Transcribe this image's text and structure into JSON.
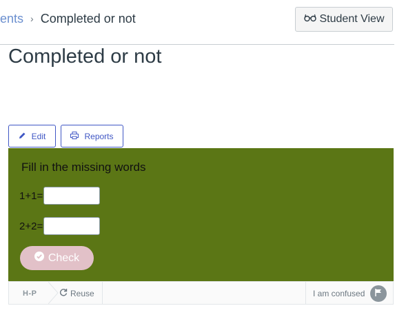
{
  "breadcrumb": {
    "parent": "ents",
    "separator": "›",
    "current": "Completed or not"
  },
  "header": {
    "student_view_label": "Student View"
  },
  "page": {
    "title": "Completed or not"
  },
  "toolbar": {
    "edit_label": "Edit",
    "reports_label": "Reports"
  },
  "h5p": {
    "task_description": "Fill in the missing words",
    "questions": [
      {
        "prompt": "1+1=",
        "value": ""
      },
      {
        "prompt": "2+2=",
        "value": ""
      }
    ],
    "check_label": "Check",
    "footer": {
      "logo": "H-P",
      "reuse_label": "Reuse",
      "confused_label": "I am confused"
    }
  },
  "colors": {
    "accent": "#3f56c4",
    "panel_bg": "#5b7615",
    "check_bg": "#e2c1c8",
    "link": "#6b8fcf"
  },
  "icons": [
    "glasses-icon",
    "pencil-icon",
    "printer-icon",
    "check-circle-icon",
    "refresh-icon",
    "flag-icon"
  ]
}
